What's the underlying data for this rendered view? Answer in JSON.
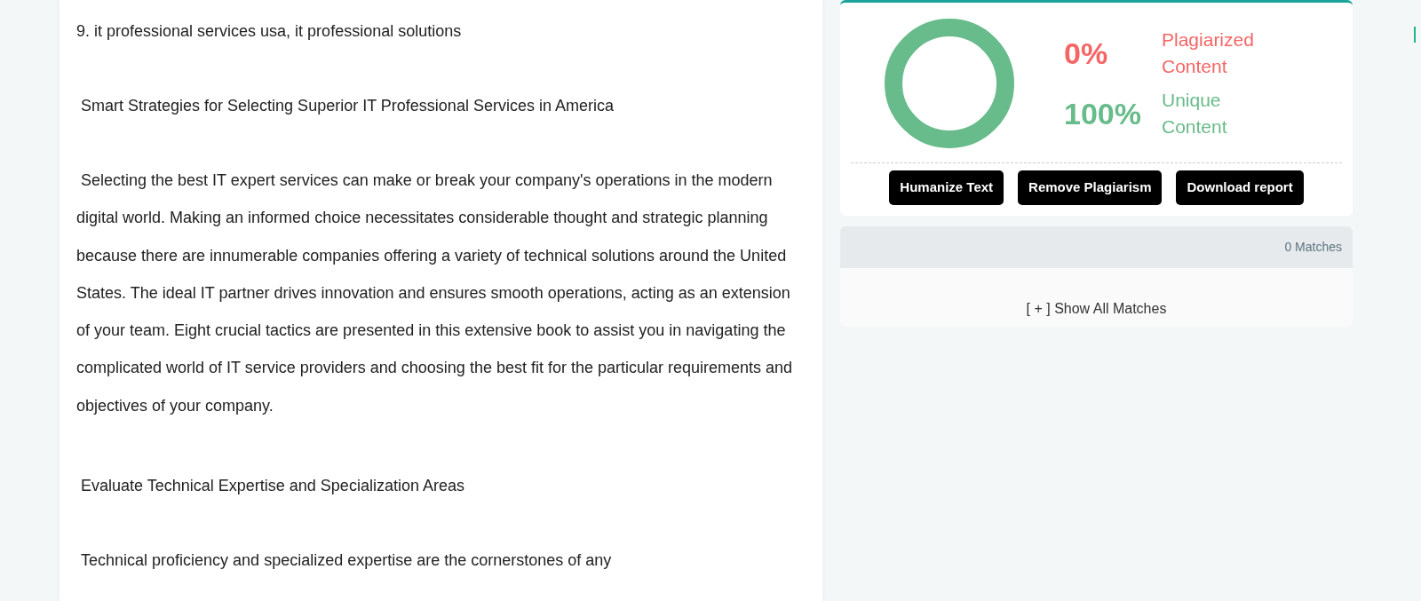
{
  "document": {
    "blocks": [
      {
        "kind": "line",
        "text": "9. it professional services usa, it professional solutions"
      },
      {
        "kind": "heading",
        "text": " Smart Strategies for Selecting Superior IT Professional Services in America"
      },
      {
        "kind": "paragraph",
        "text": " Selecting the best IT expert services can make or break your company's operations in the modern digital world. Making an informed choice necessitates considerable thought and strategic planning because there are innumerable companies offering a variety of technical solutions around the United States. The ideal IT partner drives innovation and ensures smooth operations, acting as an extension of your team. Eight crucial tactics are presented in this extensive book to assist you in navigating the complicated world of IT service providers and choosing the best fit for the particular requirements and objectives of your company."
      },
      {
        "kind": "heading",
        "text": " Evaluate Technical Expertise and Specialization Areas"
      },
      {
        "kind": "paragraph",
        "text": " Technical proficiency and specialized expertise are the cornerstones of any"
      }
    ]
  },
  "result": {
    "stats": [
      {
        "value": "0%",
        "label": "Plagiarized Content",
        "color": "#f56565"
      },
      {
        "value": "100%",
        "label": "Unique Content",
        "color": "#68bb8a"
      }
    ],
    "buttons": [
      "Humanize Text",
      "Remove Plagiarism",
      "Download report"
    ]
  },
  "matches": {
    "count": "0 Matches",
    "toggle": "[ + ] Show All Matches"
  }
}
